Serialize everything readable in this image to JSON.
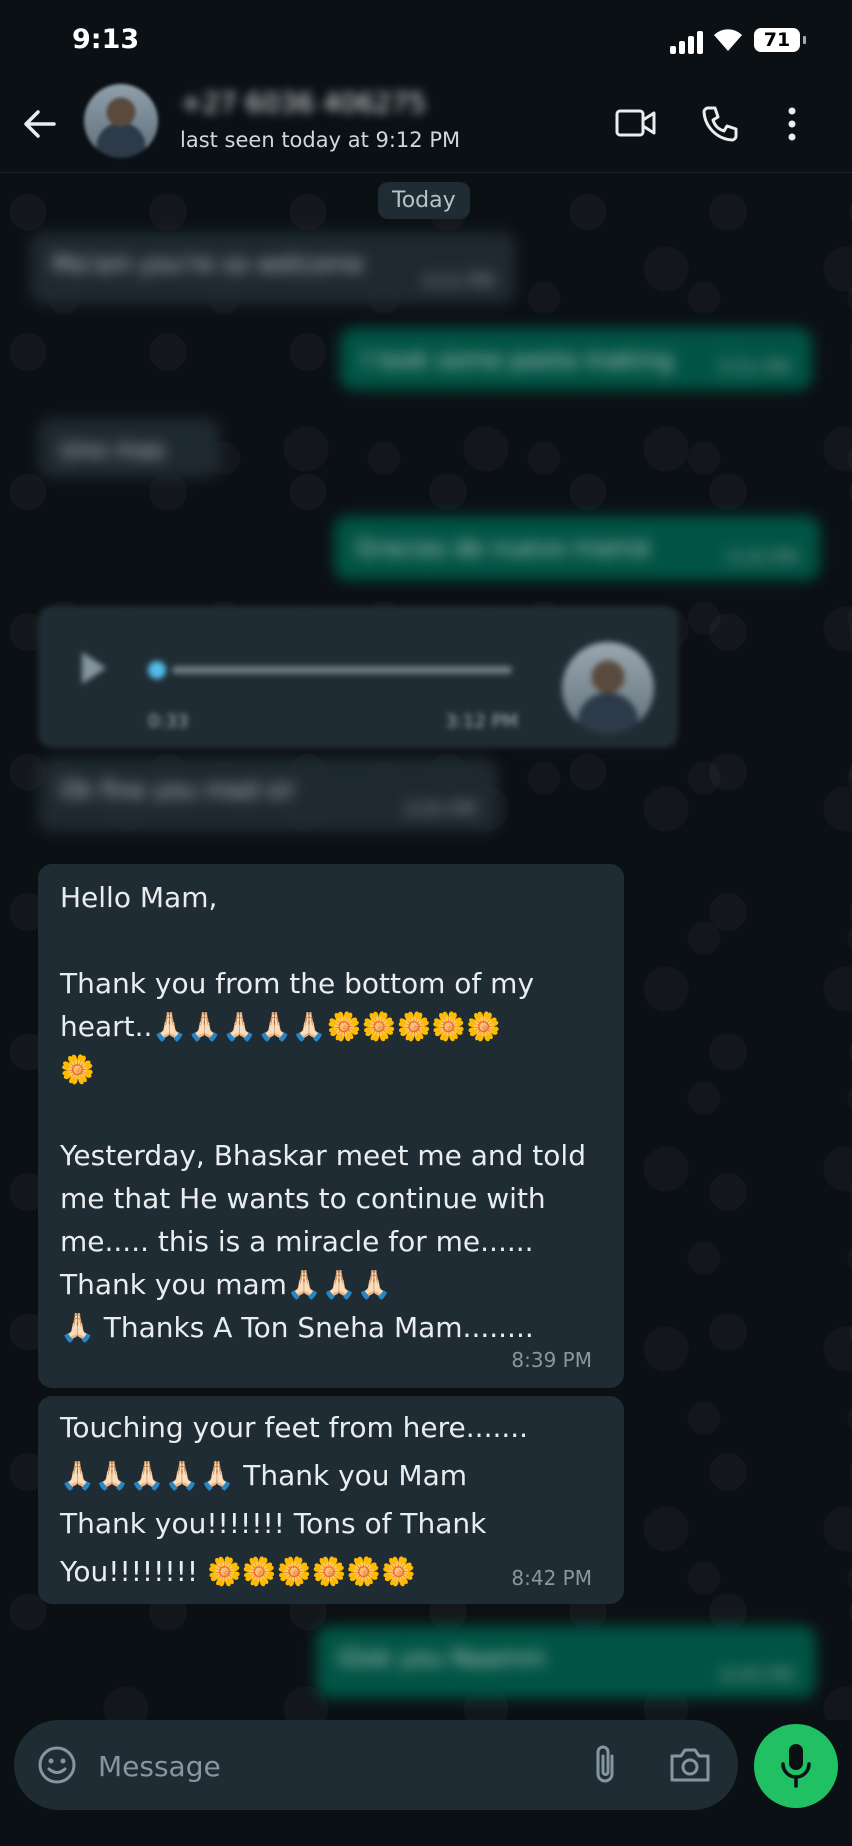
{
  "status_bar": {
    "time": "9:13",
    "battery": "71"
  },
  "header": {
    "contact_name": "+27 6036 406275",
    "last_seen": "last seen today at 9:12 PM"
  },
  "date_chip": "Today",
  "blurred_messages": [
    {
      "text": "Ma'am you're so welcome",
      "time": "3:11 PM"
    },
    {
      "text": "I took some pasta making",
      "time": "3:31 PM"
    },
    {
      "text": "Uno mas",
      "time": ""
    },
    {
      "text": "Gracias de nuevo mamá",
      "time": "3:33 PM"
    },
    {
      "voice_duration": "0:33",
      "time": "3:12 PM"
    },
    {
      "text": "Ok fine you mad sir",
      "time": "3:55 PM"
    },
    {
      "text": "Glok you Naamm",
      "time": "8:45 PM"
    }
  ],
  "messages": [
    {
      "text": "Hello Mam,\n\nThank you from the bottom of my heart..🙏🏻🙏🏻🙏🏻🙏🏻🙏🏻🌼🌼🌼🌼🌼\n🌼\n\nYesterday, Bhaskar meet me and told me that He wants to continue with me..... this is a miracle for me...... Thank you mam🙏🏻🙏🏻🙏🏻\n🙏🏻 Thanks A Ton Sneha Mam........",
      "time": "8:39 PM"
    },
    {
      "text": "Touching your feet from here.......\n🙏🏻🙏🏻🙏🏻🙏🏻🙏🏻 Thank you Mam\nThank you!!!!!!! Tons of Thank\nYou!!!!!!!! 🌼🌼🌼🌼🌼🌼",
      "time": "8:42 PM"
    }
  ],
  "composer": {
    "placeholder": "Message"
  },
  "colors": {
    "incoming": "#202c33",
    "outgoing": "#005c4b",
    "accent": "#21c063",
    "read_tick": "#53bdeb"
  },
  "icons": [
    "back-arrow-icon",
    "video-call-icon",
    "phone-icon",
    "more-options-icon",
    "play-icon",
    "emoji-icon",
    "attach-icon",
    "camera-icon",
    "mic-icon"
  ]
}
